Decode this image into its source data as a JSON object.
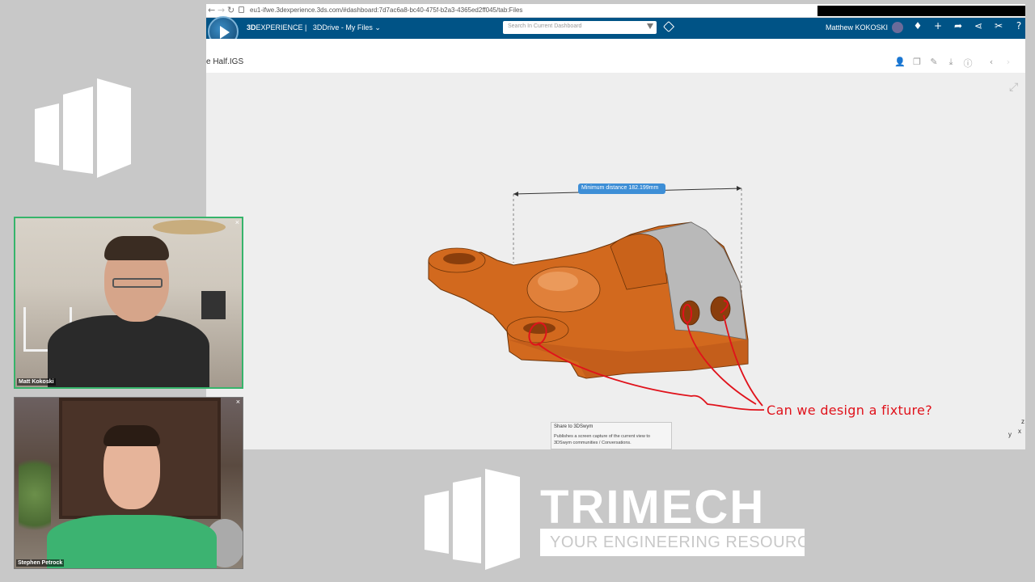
{
  "browser": {
    "url": "eu1-ifwe.3dexperience.3ds.com/#dashboard:7d7ac6a8-bc40-475f-b2a3-4365ed2ff045/tab:Files",
    "back_icon": "back-arrow-icon",
    "forward_icon": "forward-arrow-icon",
    "reload_icon": "reload-icon"
  },
  "appbar": {
    "brand_bold": "3D",
    "brand_rest": "EXPERIENCE |",
    "app_name": "3DDrive - My Files",
    "search_placeholder": "Search In Current Dashboard",
    "user_name": "Matthew KOKOSKI",
    "icons": [
      "notification-icon",
      "add-icon",
      "share-icon",
      "network-icon",
      "tools-icon",
      "help-icon"
    ]
  },
  "file_bar": {
    "file_name": "e Half.IGS",
    "icons": [
      "person-add-icon",
      "copy-icon",
      "edit-icon",
      "download-icon",
      "info-icon",
      "chevron-left-icon",
      "chevron-right-icon"
    ]
  },
  "viewer": {
    "measurement_label": "Minimum distance 182.199mm",
    "annotation_text": "Can we design a fixture?",
    "tooltip_title": "Share to 3DSwym",
    "tooltip_body": "Publishes a screen capture of the current view to 3DSwym communities / Conversations.",
    "triad_labels": [
      "z",
      "y",
      "x"
    ]
  },
  "webcams": [
    {
      "name": "Matt Kokoski"
    },
    {
      "name": "Stephen Petrock"
    }
  ],
  "branding": {
    "company": "TRIMECH",
    "tagline": "YOUR ENGINEERING RESOURCE"
  },
  "colors": {
    "appbar": "#005386",
    "part_orange": "#d2691e",
    "annotation_red": "#e0121b",
    "measure_blue": "#3d8ed6"
  }
}
